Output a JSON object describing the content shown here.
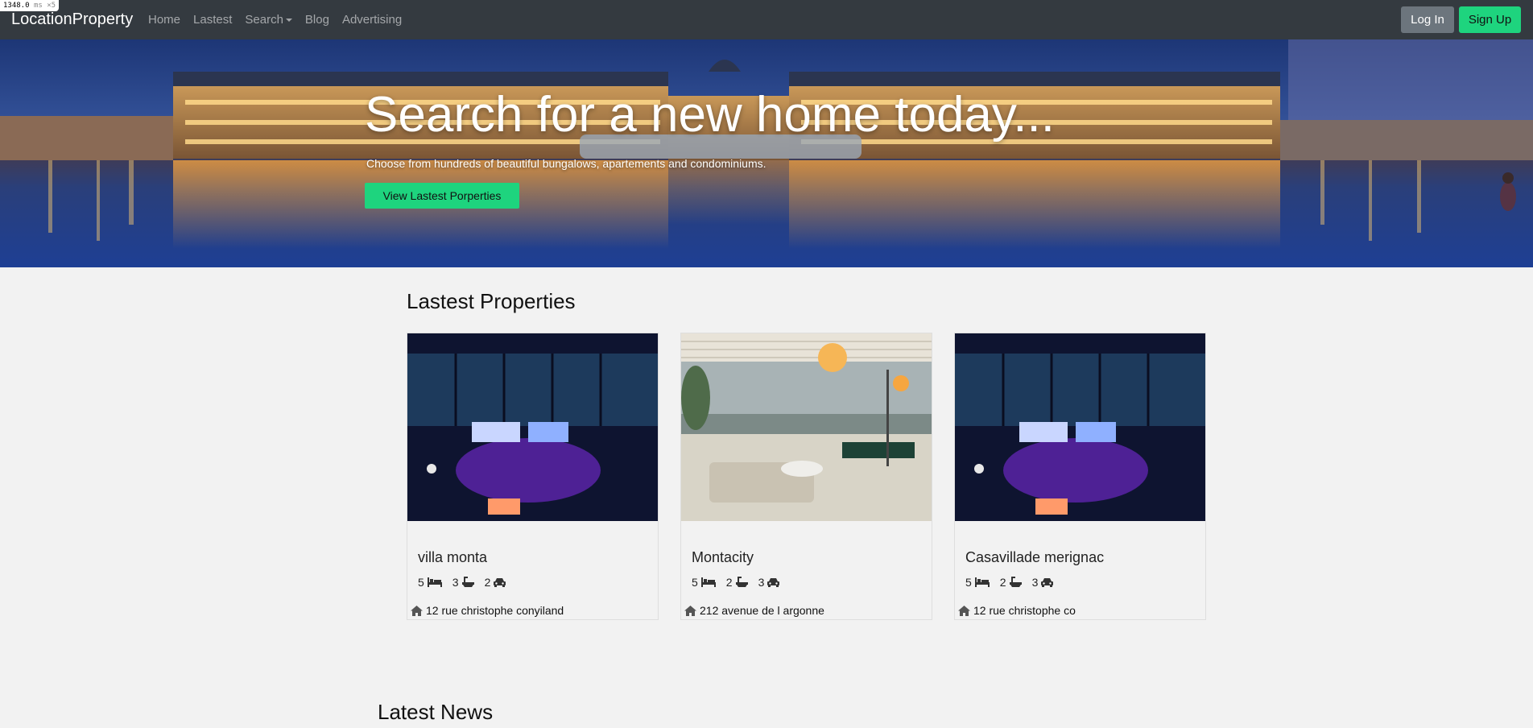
{
  "perf_badge": {
    "value": "1348.0",
    "unit": "ms ×5"
  },
  "navbar": {
    "brand": "LocationProperty",
    "links": [
      "Home",
      "Lastest",
      "Search",
      "Blog",
      "Advertising"
    ],
    "login_label": "Log In",
    "signup_label": "Sign Up"
  },
  "hero": {
    "title": "Search for a new home today...",
    "subtitle": "Choose from hundreds of beautiful bungalows, apartements and condominiums.",
    "button_label": "View Lastest Porperties"
  },
  "latest_properties": {
    "heading": "Lastest Properties",
    "cards": [
      {
        "title": "villa monta",
        "beds": "5",
        "baths": "3",
        "garages": "2",
        "address": "12 rue christophe conyiland",
        "image": "night-desk-room"
      },
      {
        "title": "Montacity",
        "beds": "5",
        "baths": "2",
        "garages": "3",
        "address": "212 avenue de l argonne",
        "image": "city-view-living-room"
      },
      {
        "title": "Casavillade merignac",
        "beds": "5",
        "baths": "2",
        "garages": "3",
        "address": "12 rue christophe co",
        "image": "night-desk-room"
      }
    ]
  },
  "latest_news": {
    "heading": "Latest News"
  },
  "colors": {
    "navbar": "#343a40",
    "accent": "#1ed47e",
    "login": "#6c757d",
    "page_bg": "#f2f2f2"
  },
  "icons": {
    "beds": "bed-icon",
    "baths": "bath-icon",
    "garages": "car-icon",
    "address": "home-icon"
  }
}
